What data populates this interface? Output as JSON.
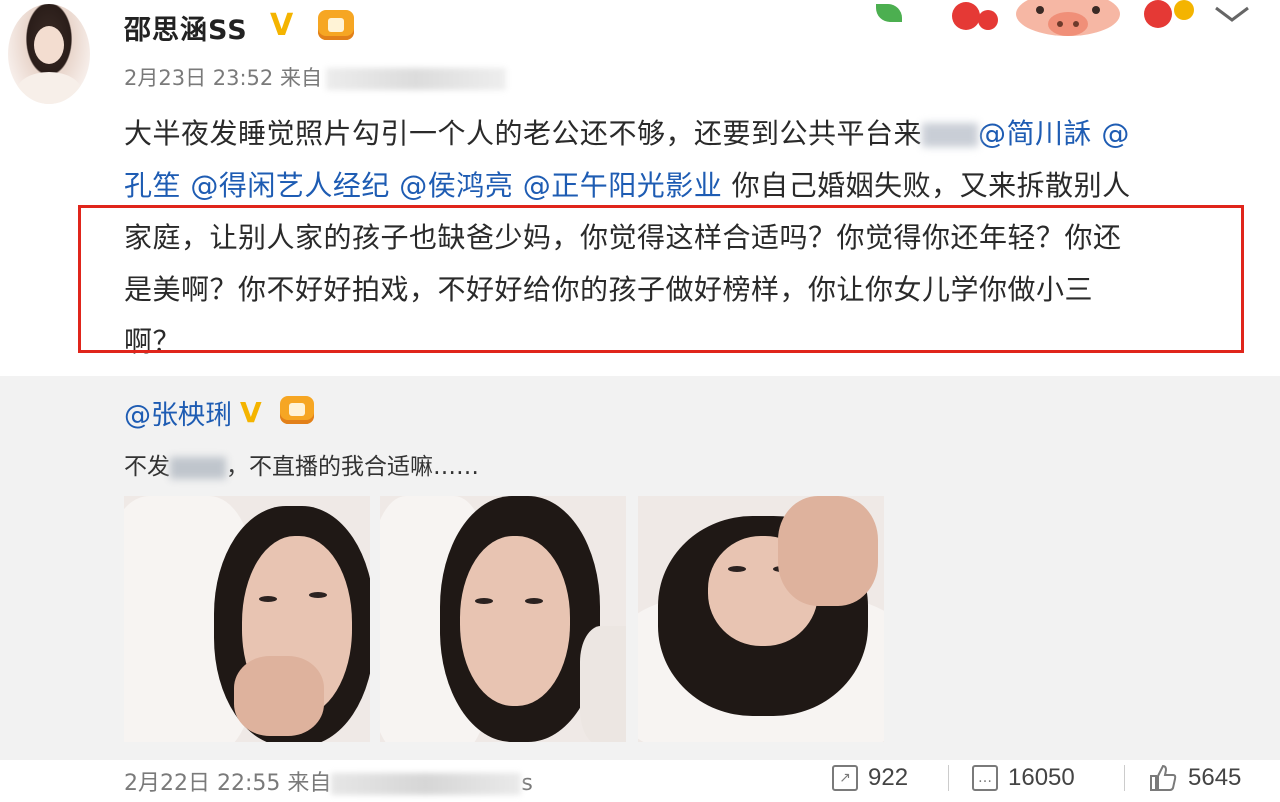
{
  "post": {
    "username": "邵思涵SS",
    "timestamp": "2月23日 23:52 来自",
    "lines": [
      {
        "a": "大半夜发睡觉照片勾引一个人的老公还不够，还要到公共平台来",
        "b": "@简川訸 @"
      },
      {
        "m1": "孔笙 @得闲艺人经纪 @侯鸿亮 @正午阳光影业",
        "t": " 你自己婚姻失败，又来拆散别人"
      },
      {
        "t": "家庭，让别人家的孩子也缺爸少妈，你觉得这样合适吗？你觉得你还年轻？你还"
      },
      {
        "t": "是美啊？你不好好拍戏，不好好给你的孩子做好榜样，你让你女儿学你做小三"
      },
      {
        "t": "啊？"
      }
    ]
  },
  "repost": {
    "username": "@张柍琍",
    "text_a": "不发",
    "text_b": "，不直播的我合适嘛……"
  },
  "footer": {
    "timestamp": "2月22日 22:55 来自",
    "suffix": "s",
    "shares": "922",
    "comments": "16050",
    "likes": "5645"
  },
  "icons": {
    "verified": "verified-v-icon",
    "member": "member-badge-icon",
    "share": "share-icon",
    "comment": "comment-icon",
    "like": "thumbs-up-icon"
  },
  "colors": {
    "mention": "#1e5cb3",
    "highlight": "#e0251b",
    "verified": "#f4b400"
  }
}
